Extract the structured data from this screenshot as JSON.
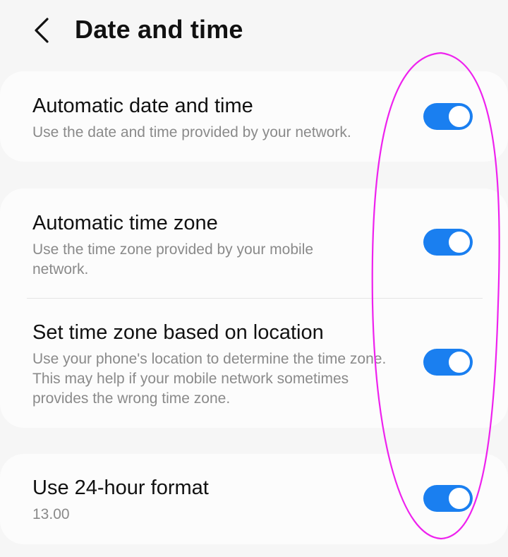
{
  "header": {
    "title": "Date and time",
    "back_icon": "chevron-left-icon"
  },
  "colors": {
    "accent": "#1a7ff0",
    "annotation": "#ee22ee"
  },
  "settings": [
    {
      "title": "Automatic date and time",
      "subtitle": "Use the date and time provided by your network.",
      "enabled": true
    },
    {
      "title": "Automatic time zone",
      "subtitle": "Use the time zone provided by your mobile network.",
      "enabled": true
    },
    {
      "title": "Set time zone based on location",
      "subtitle": "Use your phone's location to determine the time zone. This may help if your mobile network sometimes provides the wrong time zone.",
      "enabled": true
    },
    {
      "title": "Use 24-hour format",
      "subtitle": "13.00",
      "enabled": true
    }
  ]
}
